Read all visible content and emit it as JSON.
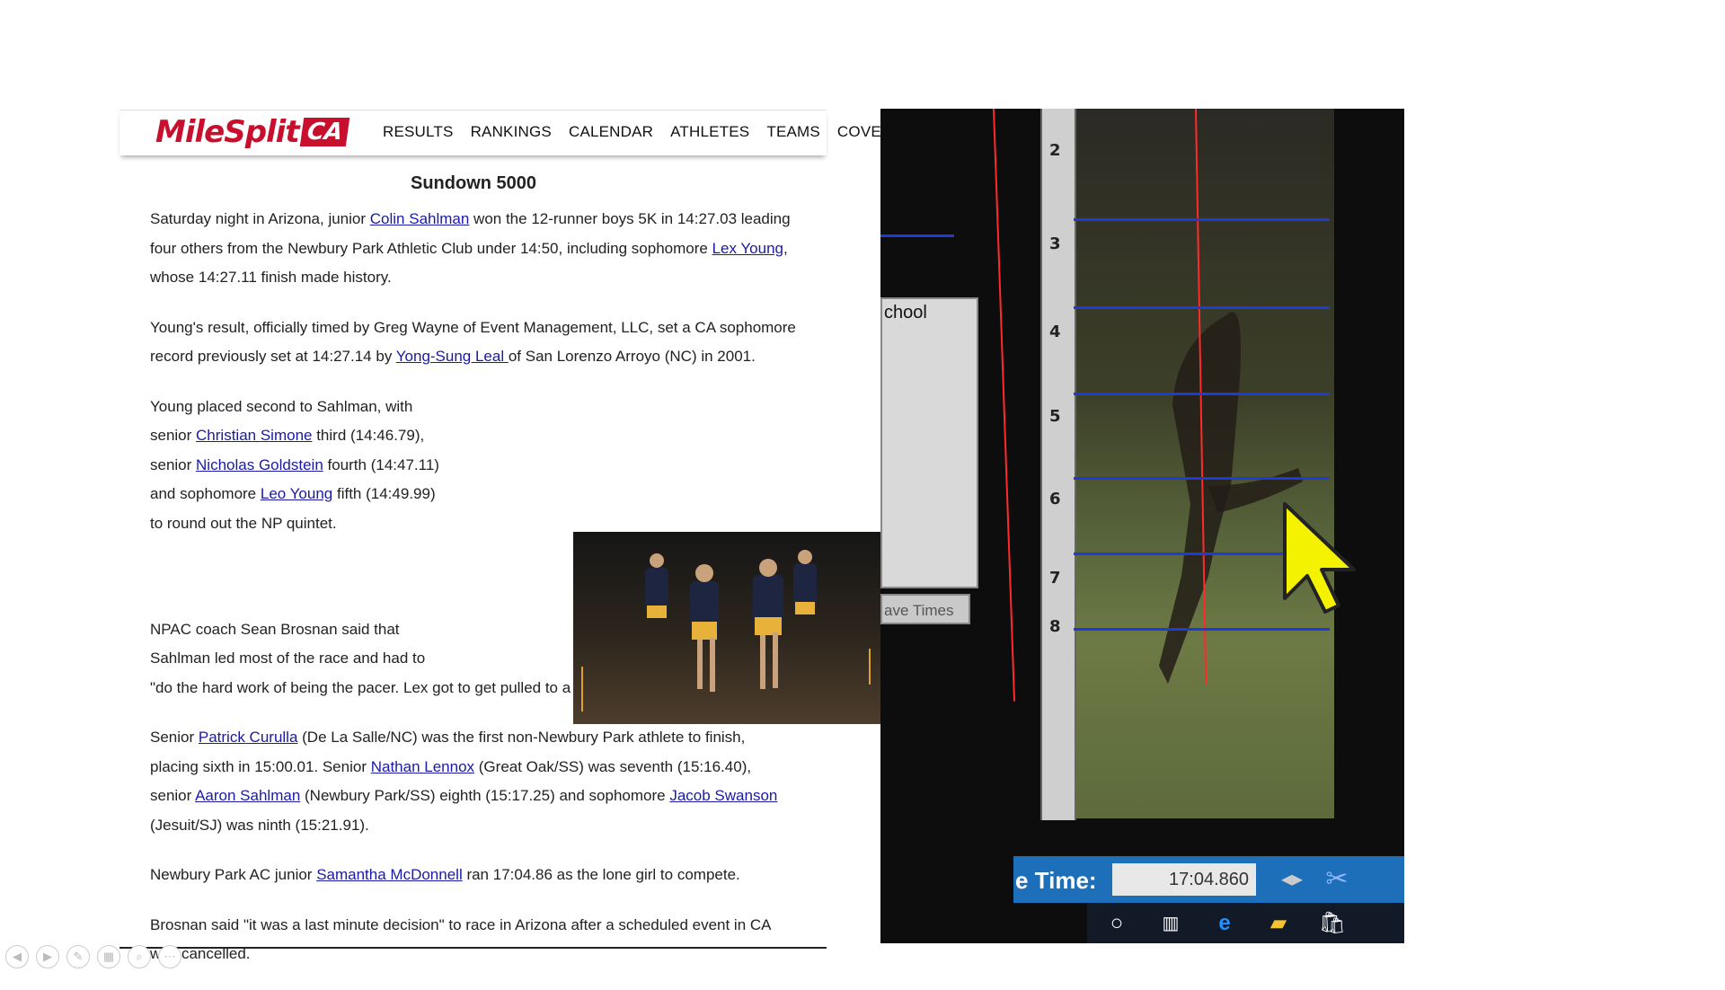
{
  "site": {
    "logo_text": "MileSplit",
    "logo_badge": "CA",
    "nav": [
      "RESULTS",
      "RANKINGS",
      "CALENDAR",
      "ATHLETES",
      "TEAMS",
      "COVER"
    ]
  },
  "article": {
    "title": "Sundown 5000",
    "p1": {
      "a": "Saturday night in Arizona, junior ",
      "link1": "Colin Sahlman",
      "b": " won the 12-runner boys 5K in 14:27.03 leading four others from the Newbury Park Athletic Club under 14:50, including sophomore ",
      "link2": "Lex Young",
      "c": ", whose 14:27.11 finish made history."
    },
    "p2": {
      "a": "Young's result, officially timed by Greg Wayne of Event Management, LLC, set a CA sophomore record previously set at 14:27.14 by ",
      "link1": "Yong-Sung Leal ",
      "b": "of San Lorenzo Arroyo (NC) in 2001."
    },
    "p3": {
      "a": "Young placed second to Sahlman, with senior ",
      "link1": "Christian Simone",
      "b": " third (14:46.79), senior ",
      "link2": "Nicholas Goldstein",
      "c": " fourth (14:47.11) and sophomore ",
      "link3": "Leo Young",
      "d": " fifth (14:49.99) to round out the NP quintet."
    },
    "p4": {
      "a": "NPAC coach Sean Brosnan said that Sahlman led most of the race and had to",
      "b": "\"do the hard work of being the pacer. Lex got to get pulled to a new CA sophomore record!\""
    },
    "p5": {
      "a": "Senior ",
      "link1": "Patrick Curulla",
      "b": " (De La Salle/NC) was the first non-Newbury Park athlete to finish, placing sixth in 15:00.01.  Senior ",
      "link2": "Nathan Lennox",
      "c": " (Great Oak/SS) was seventh (15:16.40), senior ",
      "link3": "Aaron Sahlman",
      "d": " (Newbury Park/SS) eighth (15:17.25) and sophomore ",
      "link4": "Jacob Swanson",
      "e": " (Jesuit/SJ) was ninth (15:21.91)."
    },
    "p6": {
      "a": "Newbury Park AC junior ",
      "link1": "Samantha McDonnell",
      "b": " ran 17:04.86 as the lone girl to compete."
    },
    "p7": {
      "a": "Brosnan said \"it was a last minute decision\" to race in Arizona after a scheduled event in CA was cancelled."
    }
  },
  "finish_photo": {
    "lane_numbers": [
      "2",
      "3",
      "4",
      "5",
      "6",
      "7",
      "8"
    ],
    "side_panel_label": "chool",
    "save_times_label": "ave Times",
    "time_label": "e Time:",
    "time_value": "17:04.860"
  },
  "colors": {
    "brand_red": "#c8102e",
    "link_blue": "#1a1aa6",
    "lane_blue": "#1f3bd6",
    "finish_red": "#ff2a2a",
    "cursor_yellow": "#f5f200"
  },
  "icons": {
    "taskbar": [
      "cortana-circle-icon",
      "task-view-icon",
      "edge-browser-icon",
      "file-explorer-icon",
      "store-icon"
    ],
    "slide_controls": [
      "previous-slide-icon",
      "next-slide-icon",
      "pen-icon",
      "slides-grid-icon",
      "zoom-icon",
      "more-options-icon"
    ]
  }
}
